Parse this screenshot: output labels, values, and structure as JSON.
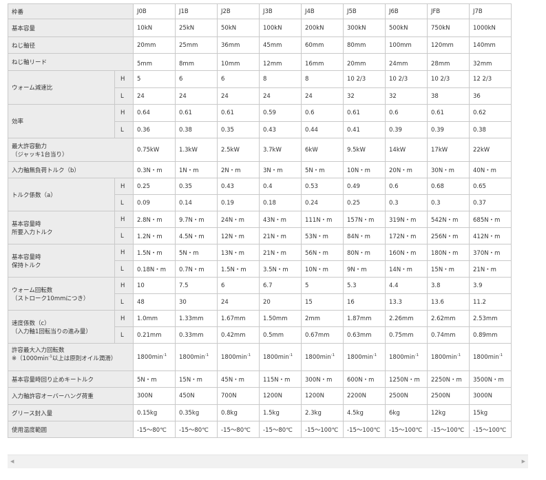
{
  "table": {
    "header": {
      "label": "枠番",
      "columns": [
        "J0B",
        "J1B",
        "J2B",
        "J3B",
        "J4B",
        "J5B",
        "J6B",
        "JFB",
        "J7B"
      ]
    },
    "rows": {
      "capacity": {
        "label": "基本容量",
        "values": [
          "10kN",
          "25kN",
          "50kN",
          "100kN",
          "200kN",
          "300kN",
          "500kN",
          "750kN",
          "1000kN"
        ]
      },
      "screw_dia": {
        "label": "ねじ軸径",
        "values": [
          "20mm",
          "25mm",
          "36mm",
          "45mm",
          "60mm",
          "80mm",
          "100mm",
          "120mm",
          "140mm"
        ]
      },
      "screw_lead": {
        "label": "ねじ軸リード",
        "values": [
          "5mm",
          "8mm",
          "10mm",
          "12mm",
          "16mm",
          "20mm",
          "24mm",
          "28mm",
          "32mm"
        ]
      },
      "worm_ratio": {
        "label": "ウォーム減速比",
        "h": {
          "sub": "H",
          "values": [
            "5",
            "6",
            "6",
            "8",
            "8",
            "10 2/3",
            "10 2/3",
            "10 2/3",
            "12 2/3"
          ]
        },
        "l": {
          "sub": "L",
          "values": [
            "24",
            "24",
            "24",
            "24",
            "24",
            "32",
            "32",
            "38",
            "36"
          ]
        }
      },
      "efficiency": {
        "label": "効率",
        "h": {
          "sub": "H",
          "values": [
            "0.64",
            "0.61",
            "0.61",
            "0.59",
            "0.6",
            "0.61",
            "0.6",
            "0.61",
            "0.62"
          ]
        },
        "l": {
          "sub": "L",
          "values": [
            "0.36",
            "0.38",
            "0.35",
            "0.43",
            "0.44",
            "0.41",
            "0.39",
            "0.39",
            "0.38"
          ]
        }
      },
      "max_power": {
        "label1": "最大許容動力",
        "label2": "（ジャッキ1台当り）",
        "values": [
          "0.75kW",
          "1.3kW",
          "2.5kW",
          "3.7kW",
          "6kW",
          "9.5kW",
          "14kW",
          "17kW",
          "22kW"
        ]
      },
      "noload_torque": {
        "label": "入力軸無負荷トルク（b）",
        "values": [
          "0.3N・m",
          "1N・m",
          "2N・m",
          "3N・m",
          "5N・m",
          "10N・m",
          "20N・m",
          "30N・m",
          "40N・m"
        ]
      },
      "torque_coef": {
        "label": "トルク係数（a）",
        "h": {
          "sub": "H",
          "values": [
            "0.25",
            "0.35",
            "0.43",
            "0.4",
            "0.53",
            "0.49",
            "0.6",
            "0.68",
            "0.65"
          ]
        },
        "l": {
          "sub": "L",
          "values": [
            "0.09",
            "0.14",
            "0.19",
            "0.18",
            "0.24",
            "0.25",
            "0.3",
            "0.3",
            "0.37"
          ]
        }
      },
      "input_torque": {
        "label1": "基本容量時",
        "label2": "所要入力トルク",
        "h": {
          "sub": "H",
          "values": [
            "2.8N・m",
            "9.7N・m",
            "24N・m",
            "43N・m",
            "111N・m",
            "157N・m",
            "319N・m",
            "542N・m",
            "685N・m"
          ]
        },
        "l": {
          "sub": "L",
          "values": [
            "1.2N・m",
            "4.5N・m",
            "12N・m",
            "21N・m",
            "53N・m",
            "84N・m",
            "172N・m",
            "256N・m",
            "412N・m"
          ]
        }
      },
      "holding_torque": {
        "label1": "基本容量時",
        "label2": "保持トルク",
        "h": {
          "sub": "H",
          "values": [
            "1.5N・m",
            "5N・m",
            "13N・m",
            "21N・m",
            "56N・m",
            "80N・m",
            "160N・m",
            "180N・m",
            "370N・m"
          ]
        },
        "l": {
          "sub": "L",
          "values": [
            "0.18N・m",
            "0.7N・m",
            "1.5N・m",
            "3.5N・m",
            "10N・m",
            "9N・m",
            "14N・m",
            "15N・m",
            "21N・m"
          ]
        }
      },
      "worm_rev": {
        "label1": "ウォーム回転数",
        "label2": "（ストローク10mmにつき）",
        "h": {
          "sub": "H",
          "values": [
            "10",
            "7.5",
            "6",
            "6.7",
            "5",
            "5.3",
            "4.4",
            "3.8",
            "3.9"
          ]
        },
        "l": {
          "sub": "L",
          "values": [
            "48",
            "30",
            "24",
            "20",
            "15",
            "16",
            "13.3",
            "13.6",
            "11.2"
          ]
        }
      },
      "speed_coef": {
        "label1": "速度係数（c）",
        "label2": "（入力軸1回転当りの進み量）",
        "h": {
          "sub": "H",
          "values": [
            "1.0mm",
            "1.33mm",
            "1.67mm",
            "1.50mm",
            "2mm",
            "1.87mm",
            "2.26mm",
            "2.62mm",
            "2.53mm"
          ]
        },
        "l": {
          "sub": "L",
          "values": [
            "0.21mm",
            "0.33mm",
            "0.42mm",
            "0.5mm",
            "0.67mm",
            "0.63mm",
            "0.75mm",
            "0.74mm",
            "0.89mm"
          ]
        }
      },
      "max_input_speed": {
        "label1": "許容最大入力回転数",
        "label2_prefix": "※（1000min",
        "label2_sup": "-1",
        "label2_suffix": "以上は原則オイル潤滑）",
        "value_base": "1800min",
        "value_sup": "-1"
      },
      "stop_key_torque": {
        "label": "基本容量時回り止めキートルク",
        "values": [
          "5N・m",
          "15N・m",
          "45N・m",
          "115N・m",
          "300N・m",
          "600N・m",
          "1250N・m",
          "2250N・m",
          "3500N・m"
        ]
      },
      "overhang": {
        "label": "入力軸許容オーバーハング荷重",
        "values": [
          "300N",
          "450N",
          "700N",
          "1200N",
          "1200N",
          "2200N",
          "2500N",
          "2500N",
          "3000N"
        ]
      },
      "grease": {
        "label": "グリース封入量",
        "values": [
          "0.15kg",
          "0.35kg",
          "0.8kg",
          "1.5kg",
          "2.3kg",
          "4.5kg",
          "6kg",
          "12kg",
          "15kg"
        ]
      },
      "temp": {
        "label": "使用温度範囲",
        "values": [
          "-15〜80℃",
          "-15〜80℃",
          "-15〜80℃",
          "-15〜80℃",
          "-15〜100℃",
          "-15〜100℃",
          "-15〜100℃",
          "-15〜100℃",
          "-15〜100℃"
        ]
      }
    }
  },
  "scrollbar": {
    "left_arrow": "◀",
    "right_arrow": "▶"
  }
}
